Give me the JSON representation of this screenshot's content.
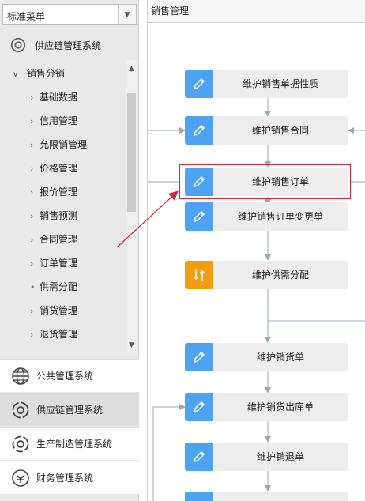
{
  "menu_select": {
    "value": "标准菜单"
  },
  "top_system": {
    "label": "供应链管理系统"
  },
  "tree": {
    "root_label": "销售分销",
    "items": [
      {
        "label": "基础数据",
        "type": "chevron"
      },
      {
        "label": "信用管理",
        "type": "chevron"
      },
      {
        "label": "允限销管理",
        "type": "chevron"
      },
      {
        "label": "价格管理",
        "type": "chevron"
      },
      {
        "label": "报价管理",
        "type": "chevron"
      },
      {
        "label": "销售预测",
        "type": "chevron"
      },
      {
        "label": "合同管理",
        "type": "chevron"
      },
      {
        "label": "订单管理",
        "type": "chevron"
      },
      {
        "label": "供需分配",
        "type": "dot"
      },
      {
        "label": "销货管理",
        "type": "chevron"
      },
      {
        "label": "退货管理",
        "type": "chevron"
      }
    ]
  },
  "bottom_systems": [
    {
      "label": "公共管理系统",
      "icon": "globe-icon",
      "active": false
    },
    {
      "label": "供应链管理系统",
      "icon": "supply-chain-icon",
      "active": true
    },
    {
      "label": "生产制造管理系统",
      "icon": "manufacturing-icon",
      "active": false
    },
    {
      "label": "财务管理系统",
      "icon": "finance-icon",
      "active": false
    }
  ],
  "panel": {
    "title": "销售管理"
  },
  "flow_nodes": [
    {
      "label": "维护销售单据性质",
      "icon": "pencil-icon"
    },
    {
      "label": "维护销售合同",
      "icon": "pencil-icon"
    },
    {
      "label": "维护销售订单",
      "icon": "pencil-icon"
    },
    {
      "label": "维护销售订单变更单",
      "icon": "pencil-icon"
    },
    {
      "label": "维护供需分配",
      "icon": "allocate-icon"
    },
    {
      "label": "维护销货单",
      "icon": "pencil-icon"
    },
    {
      "label": "维护销货出库单",
      "icon": "pencil-icon"
    },
    {
      "label": "维护销退单",
      "icon": "pencil-icon"
    }
  ],
  "colors": {
    "accent_blue": "#4da3f2",
    "accent_orange": "#f39c12",
    "highlight_red": "#dd2233"
  }
}
